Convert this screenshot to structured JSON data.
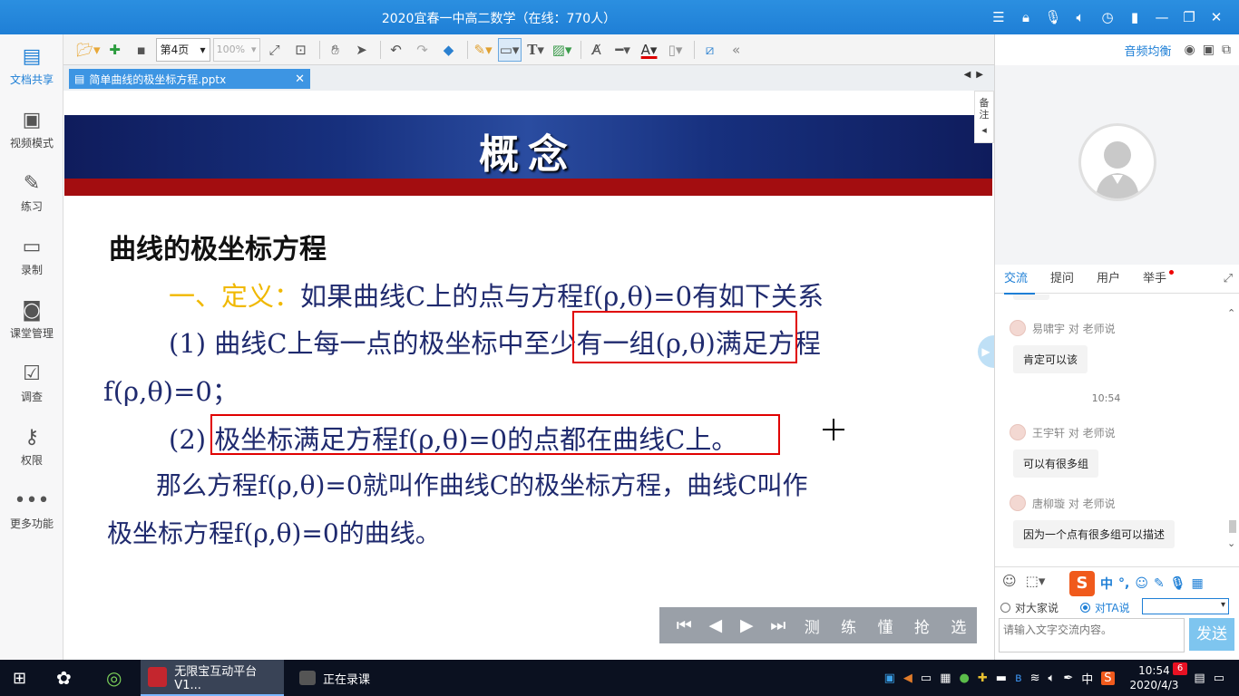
{
  "window": {
    "title": "2020宜春一中高二数学（在线：770人）"
  },
  "sidebar": {
    "items": [
      {
        "label": "文档共享",
        "icon": "document-share-icon",
        "active": true
      },
      {
        "label": "视频模式",
        "icon": "video-mode-icon"
      },
      {
        "label": "练习",
        "icon": "exercise-icon"
      },
      {
        "label": "录制",
        "icon": "record-icon"
      },
      {
        "label": "课堂管理",
        "icon": "class-manage-icon"
      },
      {
        "label": "调查",
        "icon": "survey-icon"
      },
      {
        "label": "权限",
        "icon": "permission-icon"
      },
      {
        "label": "更多功能",
        "icon": "more-icon"
      }
    ]
  },
  "toolbar": {
    "page": "第4页",
    "zoom": "100%"
  },
  "doc": {
    "tab_name": "简单曲线的极坐标方程.pptx",
    "notes_label": "备注"
  },
  "slide": {
    "title": "概念",
    "heading": "曲线的极坐标方程",
    "def_label": "一、定义：",
    "def_text": "如果曲线C上的点与方程f(ρ,θ)=0有如下关系",
    "item1_prefix": "(1) 曲线C上每一点的极坐标中",
    "item1_box": "至少有一组(ρ,θ)",
    "item1_suffix": "满足方程",
    "item1_line2": "f(ρ,θ)=0；",
    "item2_prefix": "(2) ",
    "item2_box": "极坐标满足方程f(ρ,θ)=0的点都在曲线C上",
    "item2_suffix": "。",
    "conclusion1": "那么方程f(ρ,θ)=0就叫作曲线C的极坐标方程，曲线C叫作",
    "conclusion2": "极坐标方程f(ρ,θ)=0的曲线。"
  },
  "playbar": {
    "words": [
      "测",
      "练",
      "懂",
      "抢",
      "选"
    ]
  },
  "right_panel": {
    "audio_label": "音频均衡",
    "tabs": [
      {
        "label": "交流",
        "active": true
      },
      {
        "label": "提问"
      },
      {
        "label": "用户"
      },
      {
        "label": "举手",
        "badge": true
      }
    ],
    "messages": [
      {
        "sender": "易啸宇 对 老师说",
        "text": "肯定可以该"
      },
      {
        "sender": "王宇轩 对 老师说",
        "text": "可以有很多组"
      },
      {
        "sender": "唐柳璇 对 老师说",
        "text": "因为一个点有很多组可以描述"
      }
    ],
    "time": "10:54",
    "radio_all": "对大家说",
    "radio_ta": "对TA说",
    "input_placeholder": "请输入文字交流内容。",
    "send_label": "发送",
    "ime_label": "中"
  },
  "taskbar": {
    "app1": "无限宝互动平台 V1...",
    "app2": "正在录课",
    "ime": "中",
    "time": "10:54",
    "date": "2020/4/3",
    "notification_count": "6"
  }
}
